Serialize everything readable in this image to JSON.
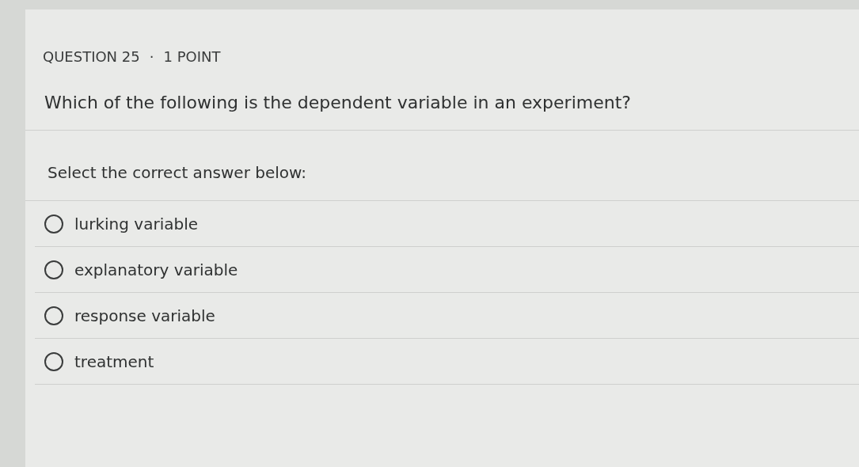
{
  "question": {
    "number": "QUESTION 25",
    "separator": "·",
    "points": "1 POINT",
    "text": "Which of the following is the dependent variable in an experiment?"
  },
  "instruction": "Select the correct answer below:",
  "options": [
    {
      "label": "lurking variable",
      "selected": false
    },
    {
      "label": "explanatory variable",
      "selected": false
    },
    {
      "label": "response variable",
      "selected": false
    },
    {
      "label": "treatment",
      "selected": false
    }
  ]
}
